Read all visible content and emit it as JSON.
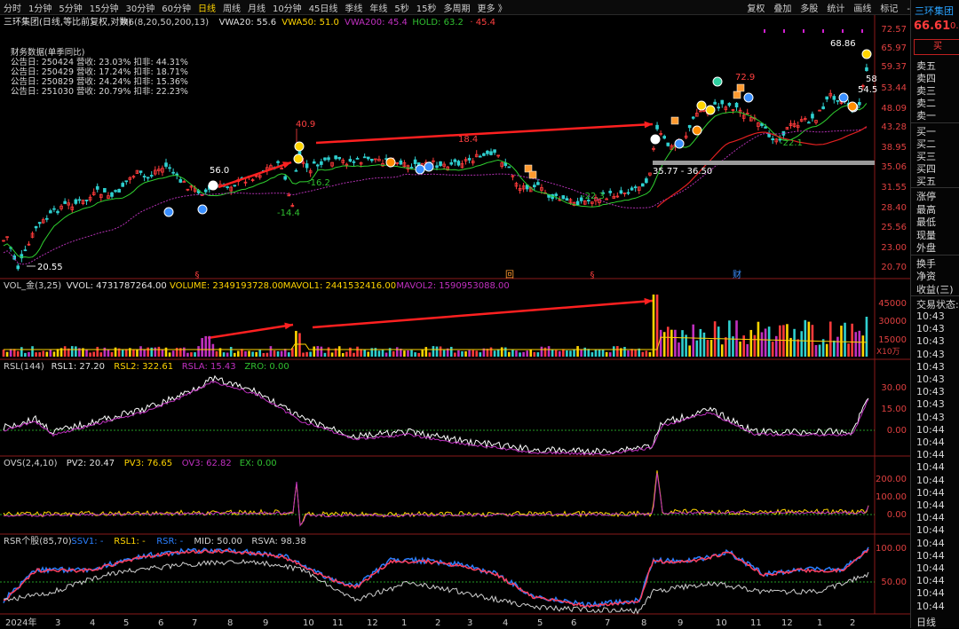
{
  "toolbar": {
    "timeframes": [
      "分时",
      "1分钟",
      "5分钟",
      "15分钟",
      "30分钟",
      "60分钟",
      "日线",
      "周线",
      "月线",
      "10分钟",
      "45日线",
      "季线",
      "年线",
      "5秒",
      "15秒",
      "多周期",
      "更多 》"
    ],
    "active": "日线",
    "tools": [
      "复权",
      "叠加",
      "多股",
      "统计",
      "画线",
      "标记",
      "-自选",
      "返回"
    ]
  },
  "main_panel": {
    "title": "三环集团(日线,等比前复权,对数)",
    "indicators": [
      {
        "text": "M6(8,20,50,200,13)",
        "color": "#d0d0d0"
      },
      {
        "text": "VWA20: 55.6",
        "color": "#e0e0e0"
      },
      {
        "text": "VWA50: 51.0",
        "color": "#ffd400"
      },
      {
        "text": "VWA200: 45.4",
        "color": "#c030c0"
      },
      {
        "text": "HOLD: 63.2",
        "color": "#30c030"
      },
      {
        "text": "· 45.4",
        "color": "#ff4040"
      }
    ],
    "fin_title": "财务数据(单季同比)",
    "fin_rows": [
      "公告日: 250424  营收: 23.03%  扣非: 44.31%",
      "公告日: 250429  营收: 17.24%  扣非: 18.71%",
      "公告日: 250829  营收: 24.24%  扣非: 15.36%",
      "公告日: 251030  营收: 20.79%  扣非: 22.23%"
    ],
    "y_ticks": [
      "72.57",
      "65.97",
      "59.37",
      "53.44",
      "48.09",
      "43.28",
      "38.95",
      "35.06",
      "31.55",
      "28.40",
      "25.56",
      "23.00",
      "20.70"
    ],
    "annotations": [
      "20.55",
      "56.0",
      "40.9",
      "-16.2",
      "-14.4",
      "18.4",
      "-22.3",
      "35.77 - 36.50",
      "72.9",
      "-22.1",
      "68.86",
      "58",
      "54.5"
    ],
    "markers": [
      "§",
      "回",
      "§",
      "财"
    ]
  },
  "volume_panel": {
    "indicators": [
      {
        "text": "VOL_金(3,25)",
        "color": "#d0d0d0"
      },
      {
        "text": "VVOL: 4731787264.00",
        "color": "#e0e0e0"
      },
      {
        "text": "VOLUME: 2349193728.00",
        "color": "#ffd400"
      },
      {
        "text": "MAVOL1: 2441532416.00",
        "color": "#ffd400"
      },
      {
        "text": "MAVOL2: 1590953088.00",
        "color": "#c030c0"
      }
    ],
    "y_ticks": [
      "45000",
      "30000",
      "15000"
    ],
    "unit": "X10万"
  },
  "rsl_panel": {
    "indicators": [
      {
        "text": "RSL(144)",
        "color": "#d0d0d0"
      },
      {
        "text": "RSL1: 27.20",
        "color": "#e0e0e0"
      },
      {
        "text": "RSL2: 322.61",
        "color": "#ffd400"
      },
      {
        "text": "RSLA: 15.43",
        "color": "#c030c0"
      },
      {
        "text": "ZRO: 0.00",
        "color": "#30c030"
      }
    ],
    "y_ticks": [
      "30.00",
      "15.00",
      "0.00"
    ]
  },
  "ovs_panel": {
    "indicators": [
      {
        "text": "OVS(2,4,10)",
        "color": "#d0d0d0"
      },
      {
        "text": "PV2: 20.47",
        "color": "#e0e0e0"
      },
      {
        "text": "PV3: 76.65",
        "color": "#ffd400"
      },
      {
        "text": "OV3: 62.82",
        "color": "#c030c0"
      },
      {
        "text": "EX: 0.00",
        "color": "#30c030"
      }
    ],
    "y_ticks": [
      "200.00",
      "100.00",
      "0.00"
    ]
  },
  "rsr_panel": {
    "indicators": [
      {
        "text": "RSR个股(85,70)",
        "color": "#d0d0d0"
      },
      {
        "text": "SSV1: -",
        "color": "#2a7fff"
      },
      {
        "text": "RSL1: -",
        "color": "#ffd400"
      },
      {
        "text": "RSR: -",
        "color": "#2a7fff"
      },
      {
        "text": "MID: 50.00",
        "color": "#d0d0d0"
      },
      {
        "text": "RSVA: 98.38",
        "color": "#d0d0d0"
      }
    ],
    "y_ticks": [
      "100.00",
      "50.00"
    ]
  },
  "x_axis": {
    "labels": [
      "2024年",
      "3",
      "4",
      "5",
      "6",
      "7",
      "8",
      "9",
      "10",
      "11",
      "12",
      "1",
      "2",
      "3",
      "4",
      "5",
      "6",
      "7",
      "8",
      "9",
      "10",
      "11",
      "12",
      "1",
      "2"
    ],
    "period": "日线"
  },
  "side_panel": {
    "stock_name": "三环集团",
    "price": "66.61",
    "price_sub": "0.",
    "buy": "买",
    "order_book": [
      "卖五",
      "卖四",
      "卖三",
      "卖二",
      "卖一",
      "买一",
      "买二",
      "买三",
      "买四",
      "买五"
    ],
    "stats": [
      "涨停",
      "最高",
      "最低",
      "现量",
      "外盘"
    ],
    "stats2": [
      "换手",
      "净资",
      "收益(三)"
    ],
    "status_label": "交易状态:",
    "times": [
      "10:43",
      "10:43",
      "10:43",
      "10:43",
      "10:43",
      "10:43",
      "10:43",
      "10:43",
      "10:43",
      "10:44",
      "10:44",
      "10:44",
      "10:44",
      "10:44",
      "10:44",
      "10:44",
      "10:44",
      "10:44",
      "10:44",
      "10:44",
      "10:44",
      "10:44",
      "10:44",
      "10:44"
    ]
  }
}
